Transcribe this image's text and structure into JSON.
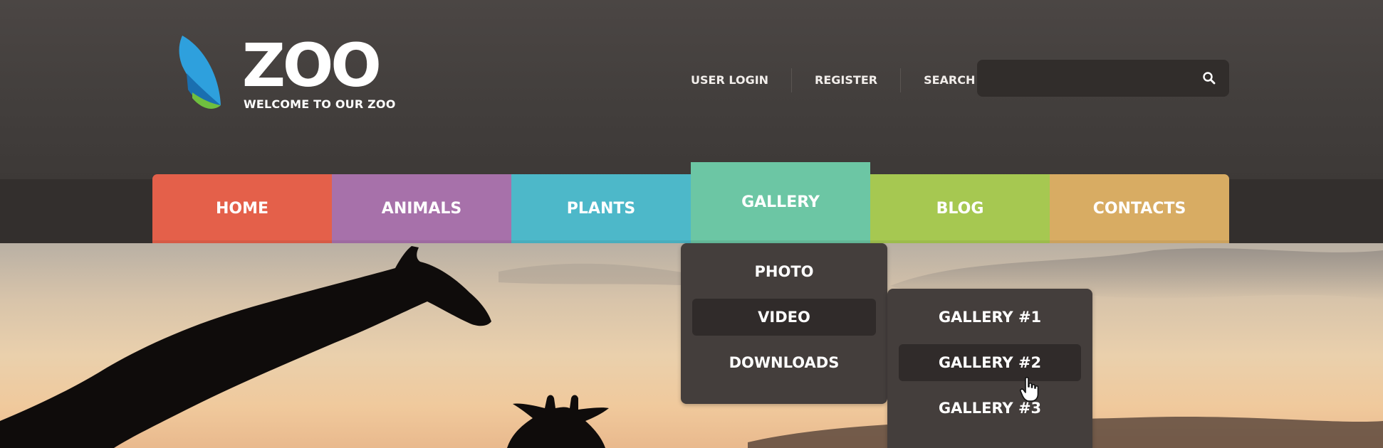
{
  "brand": {
    "title": "ZOO",
    "tagline": "WELCOME TO OUR ZOO"
  },
  "header": {
    "links": [
      {
        "label": "USER LOGIN"
      },
      {
        "label": "REGISTER"
      },
      {
        "label": "SEARCH"
      }
    ],
    "search": {
      "placeholder": "",
      "value": "",
      "icon": "search-icon"
    }
  },
  "nav": {
    "items": [
      {
        "label": "HOME",
        "color": "#e4604a"
      },
      {
        "label": "ANIMALS",
        "color": "#a771aa"
      },
      {
        "label": "PLANTS",
        "color": "#4db8c9"
      },
      {
        "label": "GALLERY",
        "color": "#6cc6a4",
        "active": true
      },
      {
        "label": "BLOG",
        "color": "#a6c851"
      },
      {
        "label": "CONTACTS",
        "color": "#d8ac63"
      }
    ]
  },
  "gallery_menu": {
    "items": [
      {
        "label": "PHOTO"
      },
      {
        "label": "VIDEO",
        "highlighted": true
      },
      {
        "label": "DOWNLOADS"
      }
    ]
  },
  "video_submenu": {
    "items": [
      {
        "label": "GALLERY #1"
      },
      {
        "label": "GALLERY #2",
        "highlighted": true
      },
      {
        "label": "GALLERY #3"
      }
    ]
  }
}
